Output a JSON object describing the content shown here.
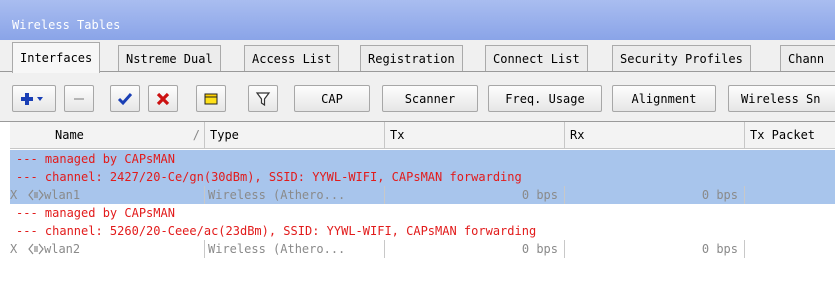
{
  "window": {
    "title": "Wireless Tables"
  },
  "tabs": [
    "Interfaces",
    "Nstreme Dual",
    "Access List",
    "Registration",
    "Connect List",
    "Security Profiles",
    "Chann"
  ],
  "toolbar": {
    "buttons": [
      "CAP",
      "Scanner",
      "Freq. Usage",
      "Alignment",
      "Wireless Sn"
    ],
    "icons": [
      "add-plus-icon",
      "remove-minus-icon",
      "enable-check-icon",
      "disable-x-icon",
      "comment-note-icon",
      "filter-funnel-icon"
    ]
  },
  "table": {
    "columns": [
      "Name",
      "Type",
      "Tx",
      "Rx",
      "Tx Packet"
    ],
    "sort_marker": "/",
    "groups": [
      {
        "comments": [
          "--- managed by CAPsMAN",
          "--- channel: 2427/20-Ce/gn(30dBm), SSID: YYWL-WIFI, CAPsMAN forwarding"
        ],
        "row": {
          "flag": "X",
          "name": "wlan1",
          "type": "Wireless (Athero...",
          "tx": "0 bps",
          "rx": "0 bps"
        },
        "selected": true
      },
      {
        "comments": [
          "--- managed by CAPsMAN",
          "--- channel: 5260/20-Ceee/ac(23dBm), SSID: YYWL-WIFI, CAPsMAN forwarding"
        ],
        "row": {
          "flag": "X",
          "name": "wlan2",
          "type": "Wireless (Athero...",
          "tx": "0 bps",
          "rx": "0 bps"
        },
        "selected": false
      }
    ]
  },
  "colors": {
    "title_bar": "#8aa4e8",
    "selection": "#a8c5ec",
    "comment_text": "#e21b1b",
    "disabled_text": "#8a8a8a"
  }
}
